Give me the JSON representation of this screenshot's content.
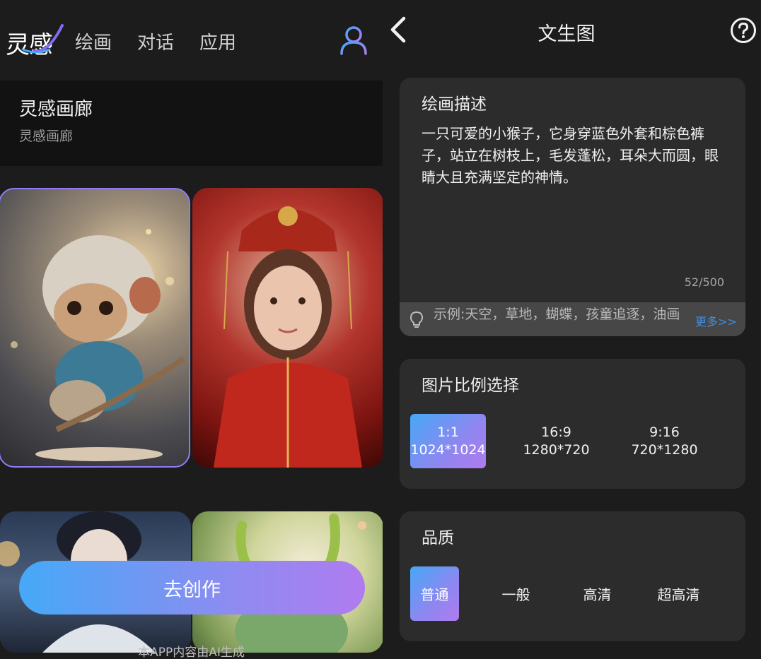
{
  "left": {
    "logo_text": "灵感",
    "nav": [
      "绘画",
      "对话",
      "应用"
    ],
    "gallery": {
      "title": "灵感画廊",
      "subtitle": "灵感画廊"
    },
    "create_button": "去创作",
    "footer_note": "本APP内容由AI生成"
  },
  "right": {
    "title": "文生图",
    "description": {
      "title": "绘画描述",
      "text": "一只可爱的小猴子，它身穿蓝色外套和棕色裤子，站立在树枝上，毛发蓬松，耳朵大而圆，眼睛大且充满坚定的神情。",
      "count": "52/500",
      "tip": "示例:天空，草地，蝴蝶，孩童追逐，油画",
      "more": "更多>>"
    },
    "ratio": {
      "title": "图片比例选择",
      "options": [
        {
          "ratio": "1:1",
          "size": "1024*1024",
          "selected": true
        },
        {
          "ratio": "16:9",
          "size": "1280*720",
          "selected": false
        },
        {
          "ratio": "9:16",
          "size": "720*1280",
          "selected": false
        }
      ]
    },
    "quality": {
      "title": "品质",
      "options": [
        "普通",
        "一般",
        "高清",
        "超高清"
      ],
      "selected": "普通"
    }
  },
  "colors": {
    "accent_start": "#45a9f7",
    "accent_end": "#b07bef",
    "link": "#3f8fe6",
    "background": "#1c1c1c",
    "panel": "#2c2c2c"
  }
}
